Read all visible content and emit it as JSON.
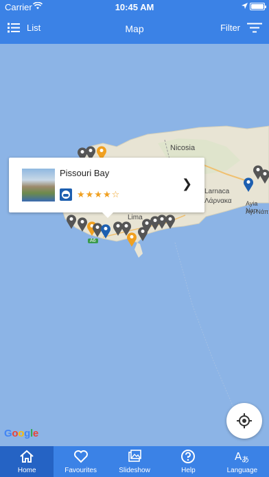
{
  "status_bar": {
    "carrier": "Carrier",
    "time": "10:45 AM",
    "battery_level": 1.0
  },
  "nav": {
    "list_label": "List",
    "title": "Map",
    "filter_label": "Filter"
  },
  "map": {
    "place_labels": [
      "Nicosia",
      "Larnaca",
      "Λάρνακα",
      "Ayia Nap",
      "Αγ. Νάπ",
      "Lima"
    ],
    "road_label": "A6",
    "attribution": "Google"
  },
  "callout": {
    "beach_name": "Pissouri Bay",
    "rating": 4,
    "max_rating": 5,
    "stars": "★★★★☆",
    "chevron": "❯"
  },
  "tabs": [
    {
      "label": "Home",
      "icon": "home-icon",
      "active": true
    },
    {
      "label": "Favourites",
      "icon": "heart-icon",
      "active": false
    },
    {
      "label": "Slideshow",
      "icon": "slideshow-icon",
      "active": false
    },
    {
      "label": "Help",
      "icon": "help-icon",
      "active": false
    },
    {
      "label": "Language",
      "icon": "language-icon",
      "active": false
    }
  ],
  "colors": {
    "nav_blue": "#3b82e6",
    "sea": "#8cb4e6",
    "land": "#e8e4d4",
    "pin_grey": "#555555",
    "pin_orange": "#f0a020",
    "pin_blue": "#1d5fb0"
  }
}
